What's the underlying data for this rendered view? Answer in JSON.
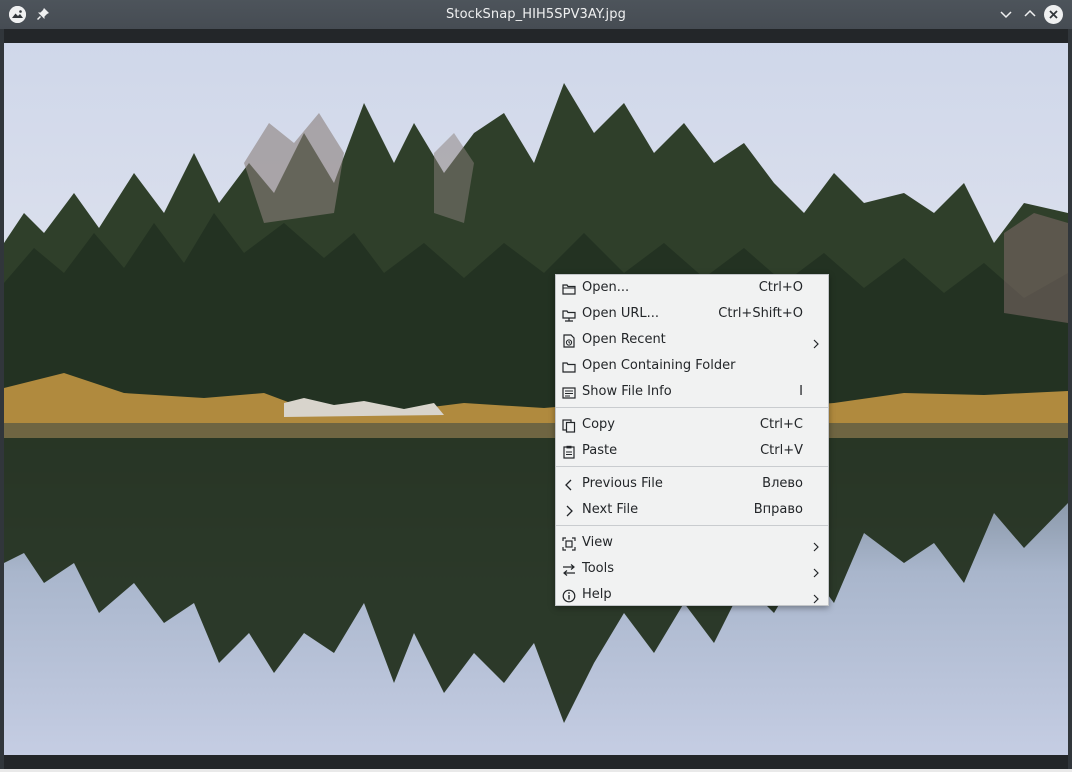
{
  "window": {
    "title": "StockSnap_HIH5SPV3AY.jpg",
    "app_icon": "gwenview-icon",
    "pin_icon": "pin-icon",
    "controls": [
      "minimize-icon",
      "maximize-icon",
      "close-icon"
    ]
  },
  "image": {
    "description_icon": "photo-canvas"
  },
  "context_menu": {
    "items": [
      {
        "label": "Open...",
        "shortcut": "Ctrl+O",
        "icon": "folder-open-icon",
        "submenu": false
      },
      {
        "label": "Open URL...",
        "shortcut": "Ctrl+Shift+O",
        "icon": "folder-network-icon",
        "submenu": false
      },
      {
        "label": "Open Recent",
        "shortcut": "",
        "icon": "document-recent-icon",
        "submenu": true
      },
      {
        "label": "Open Containing Folder",
        "shortcut": "",
        "icon": "folder-icon",
        "submenu": false
      },
      {
        "label": "Show File Info",
        "shortcut": "I",
        "icon": "file-info-icon",
        "submenu": false
      },
      {
        "label": "Copy",
        "shortcut": "Ctrl+C",
        "icon": "copy-icon",
        "submenu": false
      },
      {
        "label": "Paste",
        "shortcut": "Ctrl+V",
        "icon": "paste-icon",
        "submenu": false
      },
      {
        "label": "Previous File",
        "shortcut": "Влево",
        "icon": "chevron-left-icon",
        "submenu": false
      },
      {
        "label": "Next File",
        "shortcut": "Вправо",
        "icon": "chevron-right-icon",
        "submenu": false
      },
      {
        "label": "View",
        "shortcut": "",
        "icon": "view-icon",
        "submenu": true
      },
      {
        "label": "Tools",
        "shortcut": "",
        "icon": "tools-icon",
        "submenu": true
      },
      {
        "label": "Help",
        "shortcut": "",
        "icon": "help-icon",
        "submenu": true
      }
    ]
  }
}
